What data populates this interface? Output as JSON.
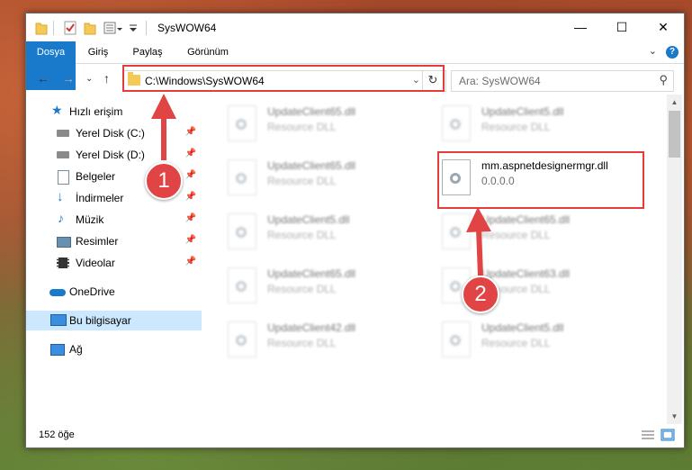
{
  "window": {
    "title": "SysWOW64"
  },
  "tabs": [
    "Dosya",
    "Giriş",
    "Paylaş",
    "Görünüm"
  ],
  "help_label": "?",
  "address": {
    "path": "C:\\Windows\\SysWOW64"
  },
  "search": {
    "placeholder": "Ara: SysWOW64"
  },
  "sidebar": {
    "items": [
      {
        "label": "Hızlı erişim",
        "icon": "star-icon"
      },
      {
        "label": "Yerel Disk (C:)",
        "icon": "drive-icon",
        "pinned": true
      },
      {
        "label": "Yerel Disk (D:)",
        "icon": "drive-icon",
        "pinned": true
      },
      {
        "label": "Belgeler",
        "icon": "document-icon",
        "pinned": true
      },
      {
        "label": "İndirmeler",
        "icon": "download-icon",
        "pinned": true
      },
      {
        "label": "Müzik",
        "icon": "music-icon",
        "pinned": true
      },
      {
        "label": "Resimler",
        "icon": "pictures-icon",
        "pinned": true
      },
      {
        "label": "Videolar",
        "icon": "video-icon",
        "pinned": true
      },
      {
        "label": "OneDrive",
        "icon": "cloud-icon"
      },
      {
        "label": "Bu bilgisayar",
        "icon": "computer-icon",
        "selected": true
      },
      {
        "label": "Ağ",
        "icon": "network-icon"
      }
    ]
  },
  "files": [
    {
      "name": "UpdateClient65.dll",
      "desc": "Resource DLL"
    },
    {
      "name": "UpdateClient5.dll",
      "desc": "Resource DLL"
    },
    {
      "name": "UpdateClient65.dll",
      "desc": "Resource DLL"
    },
    {
      "name": "mm.aspnetdesignermgr.dll",
      "desc": "0.0.0.0",
      "highlighted": true
    },
    {
      "name": "UpdateClient5.dll",
      "desc": "Resource DLL"
    },
    {
      "name": "UpdateClient65.dll",
      "desc": "Resource DLL"
    },
    {
      "name": "UpdateClient65.dll",
      "desc": "Resource DLL"
    },
    {
      "name": "UpdateClient63.dll",
      "desc": "Resource DLL"
    },
    {
      "name": "UpdateClient42.dll",
      "desc": "Resource DLL"
    },
    {
      "name": "UpdateClient5.dll",
      "desc": "Resource DLL"
    }
  ],
  "status": {
    "count": "152 öğe"
  },
  "callouts": [
    "1",
    "2"
  ],
  "colors": {
    "accent": "#1979ca",
    "highlight": "#e53b3b",
    "selected": "#cce8ff"
  }
}
